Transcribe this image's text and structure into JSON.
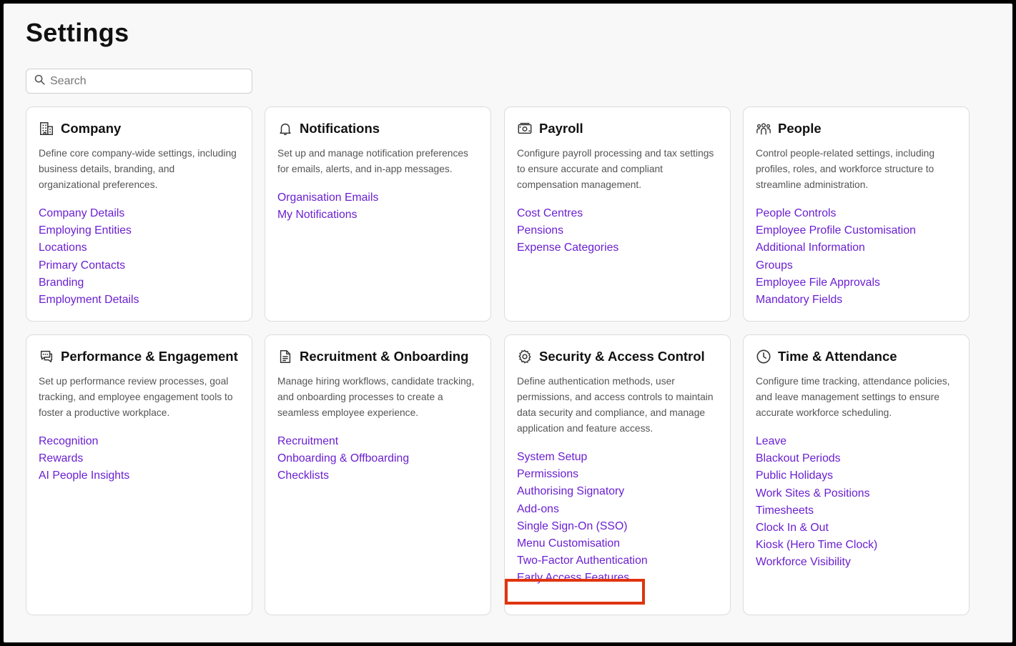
{
  "page": {
    "title": "Settings"
  },
  "search": {
    "placeholder": "Search",
    "icon": "search-icon"
  },
  "cards": [
    {
      "id": "company",
      "title": "Company",
      "icon": "building-icon",
      "description": "Define core company-wide settings, including business details, branding, and organizational preferences.",
      "links": [
        "Company Details",
        "Employing Entities",
        "Locations",
        "Primary Contacts",
        "Branding",
        "Employment Details"
      ]
    },
    {
      "id": "notifications",
      "title": "Notifications",
      "icon": "bell-icon",
      "description": "Set up and manage notification preferences for emails, alerts, and in-app messages.",
      "links": [
        "Organisation Emails",
        "My Notifications"
      ]
    },
    {
      "id": "payroll",
      "title": "Payroll",
      "icon": "money-icon",
      "description": "Configure payroll processing and tax settings to ensure accurate and compliant compensation management.",
      "links": [
        "Cost Centres",
        "Pensions",
        "Expense Categories"
      ]
    },
    {
      "id": "people",
      "title": "People",
      "icon": "people-icon",
      "description": "Control people-related settings, including profiles, roles, and workforce structure to streamline administration.",
      "links": [
        "People Controls",
        "Employee Profile Customisation",
        "Additional Information",
        "Groups",
        "Employee File Approvals",
        "Mandatory Fields"
      ]
    },
    {
      "id": "performance",
      "title": "Performance & Engagement",
      "icon": "chat-icon",
      "description": "Set up performance review processes, goal tracking, and employee engagement tools to foster a productive workplace.",
      "links": [
        "Recognition",
        "Rewards",
        "AI People Insights"
      ]
    },
    {
      "id": "recruitment",
      "title": "Recruitment & Onboarding",
      "icon": "document-icon",
      "description": "Manage hiring workflows, candidate tracking, and onboarding processes to create a seamless employee experience.",
      "links": [
        "Recruitment",
        "Onboarding & Offboarding",
        "Checklists"
      ]
    },
    {
      "id": "security",
      "title": "Security & Access Control",
      "icon": "gear-icon",
      "description": "Define authentication methods, user permissions, and access controls to maintain data security and compliance, and manage application and feature access.",
      "links": [
        "System Setup",
        "Permissions",
        "Authorising Signatory",
        "Add-ons",
        "Single Sign-On (SSO)",
        "Menu Customisation",
        "Two-Factor Authentication",
        "Early Access Features"
      ]
    },
    {
      "id": "time",
      "title": "Time & Attendance",
      "icon": "clock-icon",
      "description": "Configure time tracking, attendance policies, and leave management settings to ensure accurate workforce scheduling.",
      "links": [
        "Leave",
        "Blackout Periods",
        "Public Holidays",
        "Work Sites & Positions",
        "Timesheets",
        "Clock In & Out",
        "Kiosk (Hero Time Clock)",
        "Workforce Visibility"
      ]
    }
  ],
  "colors": {
    "link": "#6a1fd1",
    "highlight": "#e0340e"
  }
}
